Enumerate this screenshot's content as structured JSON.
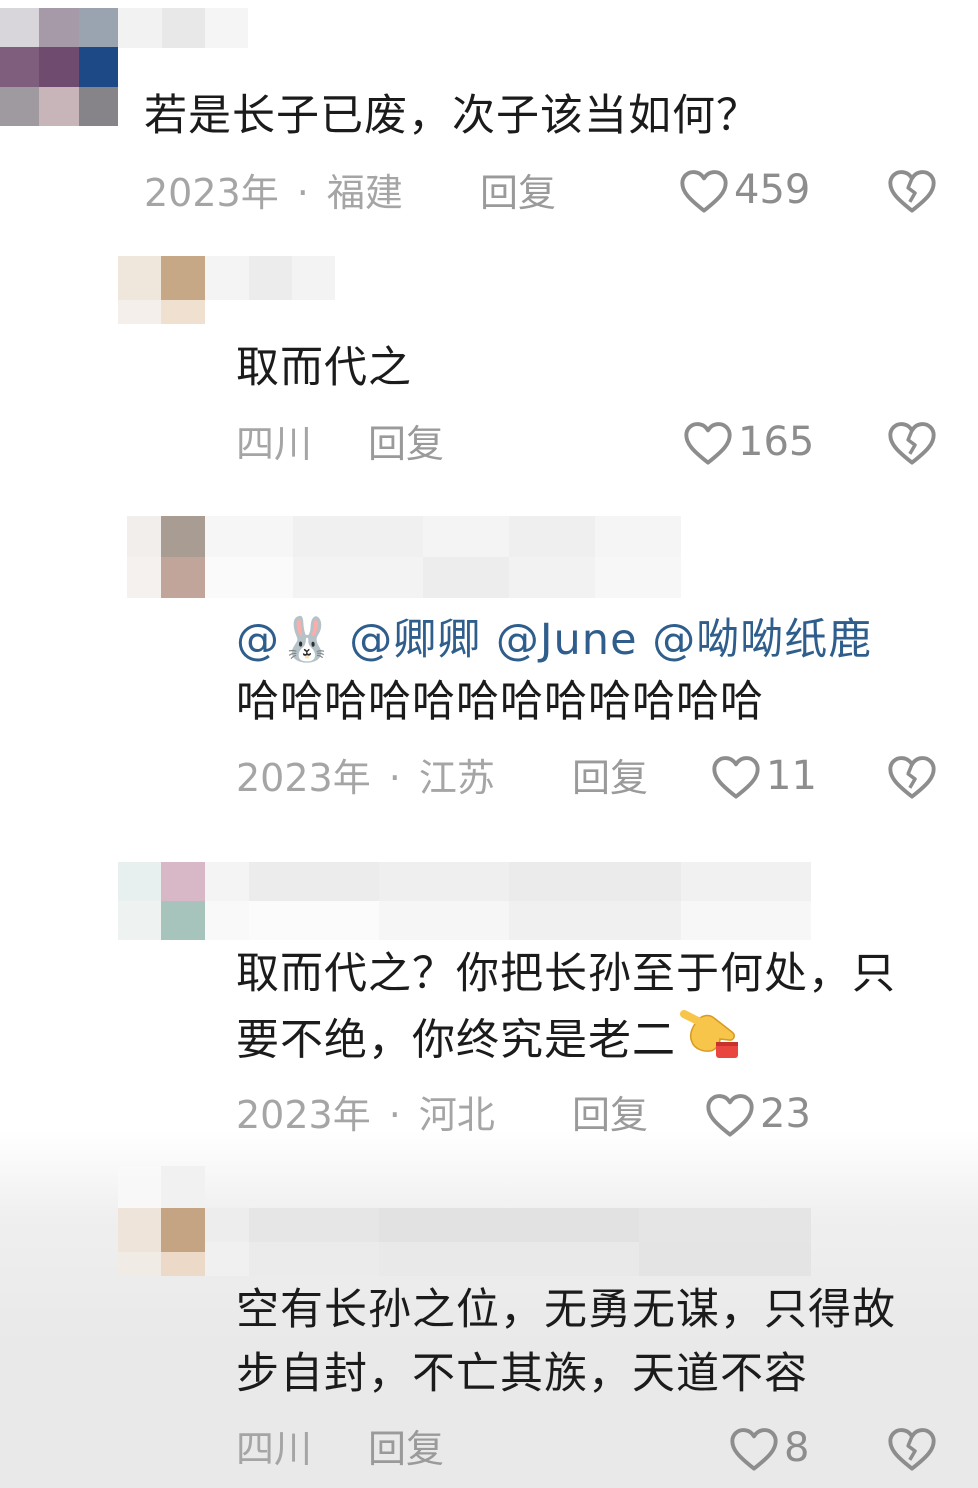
{
  "comments": [
    {
      "text": "若是长子已废，次子该当如何？",
      "time": "2023年",
      "location": "福建",
      "reply_label": "回复",
      "likes": "459"
    },
    {
      "text": "取而代之",
      "location": "四川",
      "reply_label": "回复",
      "likes": "165"
    },
    {
      "mentions": "@🐰 @卿卿 @June @呦呦纸鹿",
      "text": "哈哈哈哈哈哈哈哈哈哈哈哈",
      "time": "2023年",
      "location": "江苏",
      "reply_label": "回复",
      "likes": "11"
    },
    {
      "text_line1": "取而代之？你把长孙至于何处，只",
      "text_line2": "要不绝，你终究是老二",
      "emoji": "pointing-hand-emoji",
      "time": "2023年",
      "location": "河北",
      "reply_label": "回复",
      "likes": "23"
    },
    {
      "text_line1": "空有长孙之位，无勇无谋，只得故",
      "text_line2": "步自封，不亡其族，天道不容",
      "location": "四川",
      "reply_label": "回复",
      "likes": "8"
    }
  ],
  "colors": {
    "text": "#1b1b1b",
    "meta": "#a5a5a5",
    "mention": "#2f5e8c",
    "icon": "#8d8d8d"
  }
}
